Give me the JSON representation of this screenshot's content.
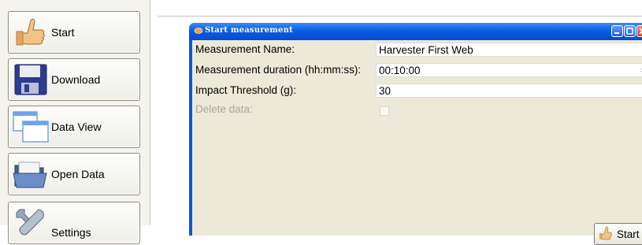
{
  "sidebar": {
    "items": [
      {
        "label": "Start",
        "icon": "thumbs-up-icon"
      },
      {
        "label": "Download",
        "icon": "floppy-disk-icon"
      },
      {
        "label": "Data View",
        "icon": "windows-icon"
      },
      {
        "label": "Open Data",
        "icon": "open-folder-icon"
      },
      {
        "label": "Settings",
        "icon": "tools-icon"
      }
    ]
  },
  "dialog": {
    "title": "Start measurement",
    "fields": [
      {
        "label": "Measurement Name:",
        "value": "Harvester First Web"
      },
      {
        "label": "Measurement duration (hh:mm:ss):",
        "value": "00:10:00"
      },
      {
        "label": "Impact Threshold (g):",
        "value": "30"
      },
      {
        "label": "Delete data:",
        "value": ""
      }
    ],
    "start_label": "Start"
  },
  "colors": {
    "title_bar": "#0b5ce6",
    "dialog_bg": "#ece9d8",
    "disabled_text": "#a8a79b"
  }
}
